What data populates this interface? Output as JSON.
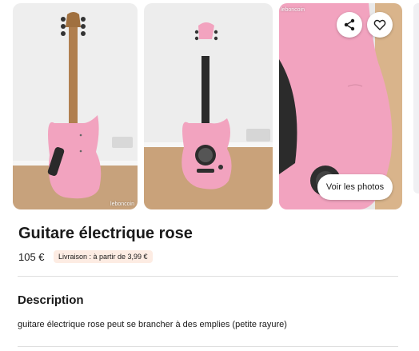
{
  "gallery": {
    "photos": [
      {
        "alt": "guitar-back-view",
        "watermark": "leboncoin"
      },
      {
        "alt": "guitar-front-view"
      },
      {
        "alt": "guitar-body-closeup",
        "watermark": "leboncoin"
      }
    ],
    "share_icon": "share-icon",
    "favorite_icon": "heart-icon",
    "view_photos_label": "Voir les photos"
  },
  "listing": {
    "title": "Guitare électrique rose",
    "price": "105 €",
    "delivery": "Livraison : à partir de 3,99 €"
  },
  "description": {
    "heading": "Description",
    "text": "guitare électrique rose peut se brancher à des emplies (petite rayure)"
  },
  "colors": {
    "guitar_pink": "#f2a3bf",
    "delivery_badge_bg": "#fdece3",
    "wall": "#ececec",
    "floor": "#c9a27a"
  }
}
